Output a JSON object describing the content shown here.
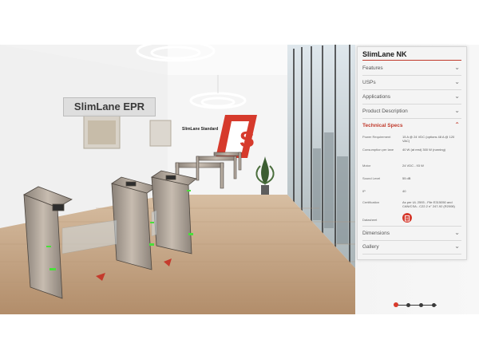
{
  "scene": {
    "overlay_label": "SlimLane EPR",
    "wall_sign": "SlimLane Standard"
  },
  "panel": {
    "title": "SlimLane NK",
    "sections": [
      {
        "label": "Features",
        "expanded": false
      },
      {
        "label": "USPs",
        "expanded": false
      },
      {
        "label": "Applications",
        "expanded": false
      },
      {
        "label": "Product Description",
        "expanded": false
      },
      {
        "label": "Technical Specs",
        "expanded": true
      },
      {
        "label": "Dimensions",
        "expanded": false
      },
      {
        "label": "Gallery",
        "expanded": false
      }
    ],
    "specs": [
      {
        "key": "Power Requirement",
        "value": "15 A @ 24 VDC (options 48 A @ 120 VAC)"
      },
      {
        "key": "Consumption per lane",
        "value": "40 W (at rest) 300 W (running)"
      },
      {
        "key": "Motor",
        "value": "24 VDC - 93 W"
      },
      {
        "key": "Sound Level",
        "value": "55 dB"
      },
      {
        "key": "IP",
        "value": "40"
      },
      {
        "key": "Certification",
        "value": "As per UL 2593 - File E315050 and CAN/CSA - C22.2 n° 247-92 (R2008)"
      },
      {
        "key": "Datasheet",
        "value": ""
      }
    ],
    "datasheet_icon": "document-icon"
  },
  "colors": {
    "accent": "#c0392b",
    "panel_bg": "#f4f4f4",
    "floor": "#c9a98a"
  },
  "navigation": {
    "dot_count": 4,
    "active_index": 0
  }
}
